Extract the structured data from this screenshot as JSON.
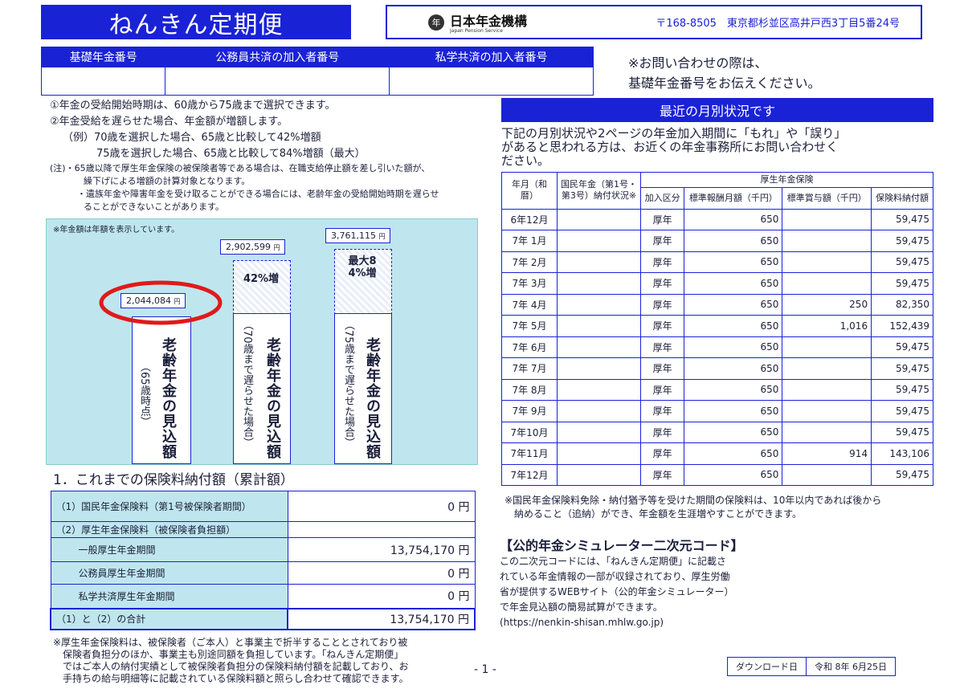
{
  "header": {
    "title": "ねんきん定期便",
    "org_name": "日本年金機構",
    "org_sub": "Japan Pension Service",
    "address": "〒168-8505　東京都杉並区高井戸西3丁目5番24号"
  },
  "numbers": {
    "col1": "基礎年金番号",
    "col2": "公務員共済の加入者番号",
    "col3": "私学共済の加入者番号"
  },
  "inquiry": {
    "line1": "※お問い合わせの際は、",
    "line2": "基礎年金番号をお伝えください。"
  },
  "notes": {
    "n1": "①年金の受給開始時期は、60歳から75歳まで選択できます。",
    "n2": "②年金受給を遅らせた場合、年金額が増額します。",
    "ex1": "（例）70歳を選択した場合、65歳と比較して42%増額",
    "ex2": "75歳を選択した場合、65歳と比較して84%増額（最大）",
    "c1a": "(注)・65歳以降で厚生年金保険の被保険者等である場合は、在職支給停止額を差し引いた額が、",
    "c1b": "繰下げによる増額の計算対象となります。",
    "c2a": "・遺族年金や障害年金を受け取ることができる場合には、老齢年金の受給開始時期を遅らせ",
    "c2b": "ることができないことがあります。"
  },
  "chart": {
    "note": "※年金額は年額を表示しています。",
    "v65": "2,044,084",
    "v70": "2,902,599",
    "v75": "3,761,115",
    "unit": "円",
    "inc70": "42%増",
    "inc75": "最大84%増",
    "bar_title": "老齢年金の見込額",
    "sub65": "（65歳時点）",
    "sub70": "（70歳まで遅らせた場合）",
    "sub75": "（75歳まで遅らせた場合）"
  },
  "chart_data": {
    "type": "bar",
    "categories": [
      "65歳時点",
      "70歳まで遅らせた場合",
      "75歳まで遅らせた場合"
    ],
    "values": [
      2044084,
      2902599,
      3761115
    ],
    "title": "",
    "xlabel": "",
    "ylabel": ""
  },
  "payments": {
    "heading": "1．これまでの保険料納付額（累計額）",
    "rows": [
      {
        "label": "（1）国民年金保険料（第1号被保険者期間）",
        "value": "0 円"
      },
      {
        "label": "（2）厚生年金保険料（被保険者負担額）",
        "value": ""
      },
      {
        "label": "一般厚生年金期間",
        "value": "13,754,170 円"
      },
      {
        "label": "公務員厚生年金期間",
        "value": "0 円"
      },
      {
        "label": "私学共済厚生年金期間",
        "value": "0 円"
      },
      {
        "label": "（1）と（2）の合計",
        "value": "13,754,170 円"
      }
    ],
    "footnote1": "※厚生年金保険料は、被保険者（ご本人）と事業主で折半することとされており被",
    "footnote2": "保険者負担分のほか、事業主も別途同額を負担しています。「ねんきん定期便」",
    "footnote3": "ではご本人の納付実績として被保険者負担分の保険料納付額を記載しており、お",
    "footnote4": "手持ちの給与明細等に記載されている保険料額と照らし合わせて確認できます。",
    "page": "- 1 -"
  },
  "monthly": {
    "heading": "最近の月別状況です",
    "intro1": "下記の月別状況や2ページの年金加入期間に「もれ」や「誤り」",
    "intro2": "があると思われる方は、お近くの年金事務所にお問い合わせく",
    "intro3": "ださい。",
    "h_month": "年月（和暦）",
    "h_kokumin": "国民年金（第1号・第3号）納付状況※",
    "h_kosei": "厚生年金保険",
    "h_kubun": "加入区分",
    "h_hyojun": "標準報酬月額（千円）",
    "h_shoyo": "標準賞与額（千円）",
    "h_hokenryo": "保険料納付額",
    "rows": [
      [
        "6年12月",
        "",
        "厚年",
        "650",
        "",
        "59,475"
      ],
      [
        "7年 1月",
        "",
        "厚年",
        "650",
        "",
        "59,475"
      ],
      [
        "7年 2月",
        "",
        "厚年",
        "650",
        "",
        "59,475"
      ],
      [
        "7年 3月",
        "",
        "厚年",
        "650",
        "",
        "59,475"
      ],
      [
        "7年 4月",
        "",
        "厚年",
        "650",
        "250",
        "82,350"
      ],
      [
        "7年 5月",
        "",
        "厚年",
        "650",
        "1,016",
        "152,439"
      ],
      [
        "7年 6月",
        "",
        "厚年",
        "650",
        "",
        "59,475"
      ],
      [
        "7年 7月",
        "",
        "厚年",
        "650",
        "",
        "59,475"
      ],
      [
        "7年 8月",
        "",
        "厚年",
        "650",
        "",
        "59,475"
      ],
      [
        "7年 9月",
        "",
        "厚年",
        "650",
        "",
        "59,475"
      ],
      [
        "7年10月",
        "",
        "厚年",
        "650",
        "",
        "59,475"
      ],
      [
        "7年11月",
        "",
        "厚年",
        "650",
        "914",
        "143,106"
      ],
      [
        "7年12月",
        "",
        "厚年",
        "650",
        "",
        "59,475"
      ]
    ],
    "note1": "※国民年金保険料免除・納付猶予等を受けた期間の保険料は、10年以内であれば後から",
    "note2": "納めること（追納）ができ、年金額を生涯増やすことができます。"
  },
  "simulator": {
    "title": "【公的年金シミュレーター二次元コード】",
    "l1": "この二次元コードには、「ねんきん定期便」に記載さ",
    "l2": "れている年金情報の一部が収録されており、厚生労働",
    "l3": "省が提供するWEBサイト（公的年金シミュレーター）",
    "l4": "で年金見込額の簡易試算ができます。",
    "url": "(https://nenkin-shisan.mhlw.go.jp)"
  },
  "download": {
    "label": "ダウンロード日",
    "date": "令和 8年 6月25日"
  },
  "colors": {
    "brand": "#1a22d6",
    "chart_bg": "#bfe6ee",
    "highlight": "#e01a1a"
  }
}
